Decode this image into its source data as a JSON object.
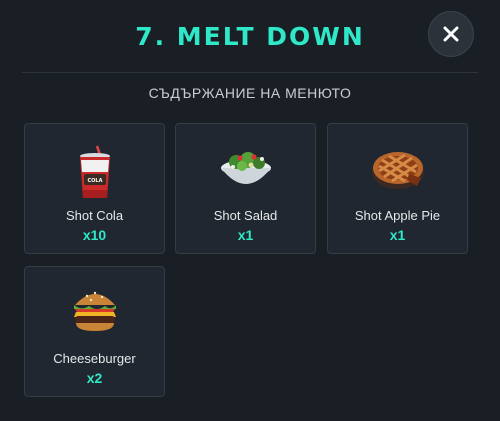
{
  "modal": {
    "title": "7. MELT DOWN",
    "subtitle": "СЪДЪРЖАНИЕ НА МЕНЮТО",
    "close_icon": "close-icon"
  },
  "items": [
    {
      "name": "Shot Cola",
      "qty": "x10",
      "icon": "cola-cup-icon"
    },
    {
      "name": "Shot Salad",
      "qty": "x1",
      "icon": "salad-bowl-icon"
    },
    {
      "name": "Shot Apple Pie",
      "qty": "x1",
      "icon": "apple-pie-icon"
    },
    {
      "name": "Cheeseburger",
      "qty": "x2",
      "icon": "cheeseburger-icon"
    }
  ],
  "colors": {
    "accent": "#2ee8c8",
    "background": "#1a1f25",
    "card": "#212730"
  }
}
